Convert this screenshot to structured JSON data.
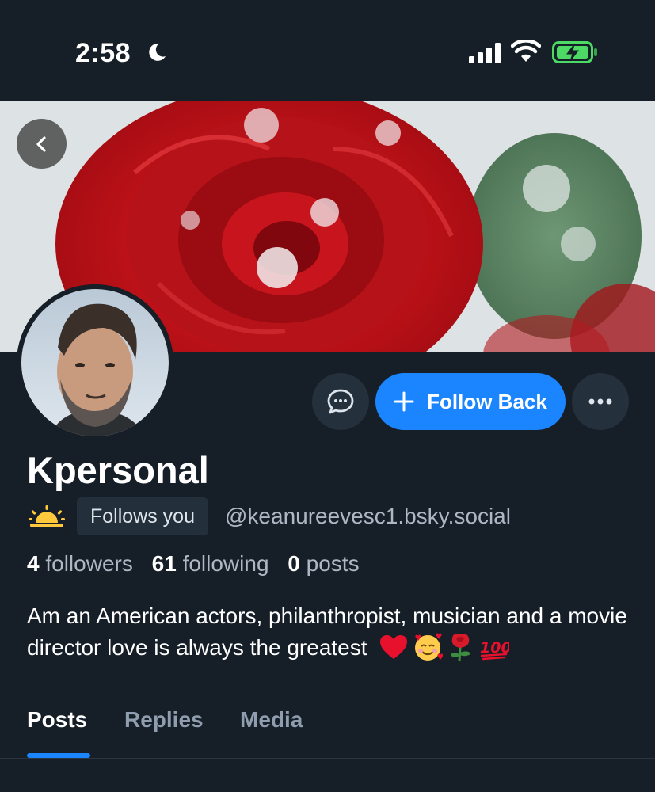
{
  "status_bar": {
    "time": "2:58"
  },
  "icons": {
    "back": "chevron-left-icon",
    "message": "chat-bubble-icon",
    "follow": "plus-icon",
    "more": "ellipsis-icon",
    "moon": "moon-icon",
    "signal": "cellular-signal-icon",
    "wifi": "wifi-icon",
    "battery": "battery-charging-icon",
    "sun": "sunrise-emoji",
    "bio_emojis": [
      "red-heart-emoji",
      "smiling-face-with-hearts-emoji",
      "rose-emoji",
      "hundred-points-emoji"
    ]
  },
  "colors": {
    "background": "#161e27",
    "accent": "#1a85ff",
    "muted_text": "#aeb8c4",
    "button_secondary": "#25303d",
    "battery_green": "#4cd964"
  },
  "profile": {
    "display_name": "Kpersonal",
    "follows_you": "Follows you",
    "handle": "@keanureevesc1.bsky.social",
    "stats": {
      "followers_count": "4",
      "followers_label": "followers",
      "following_count": "61",
      "following_label": "following",
      "posts_count": "0",
      "posts_label": "posts"
    },
    "bio": "Am an American actors, philanthropist, musician and a movie director love is always the greatest"
  },
  "actions": {
    "follow_label": "Follow Back"
  },
  "tabs": [
    {
      "label": "Posts",
      "active": true
    },
    {
      "label": "Replies",
      "active": false
    },
    {
      "label": "Media",
      "active": false
    }
  ]
}
